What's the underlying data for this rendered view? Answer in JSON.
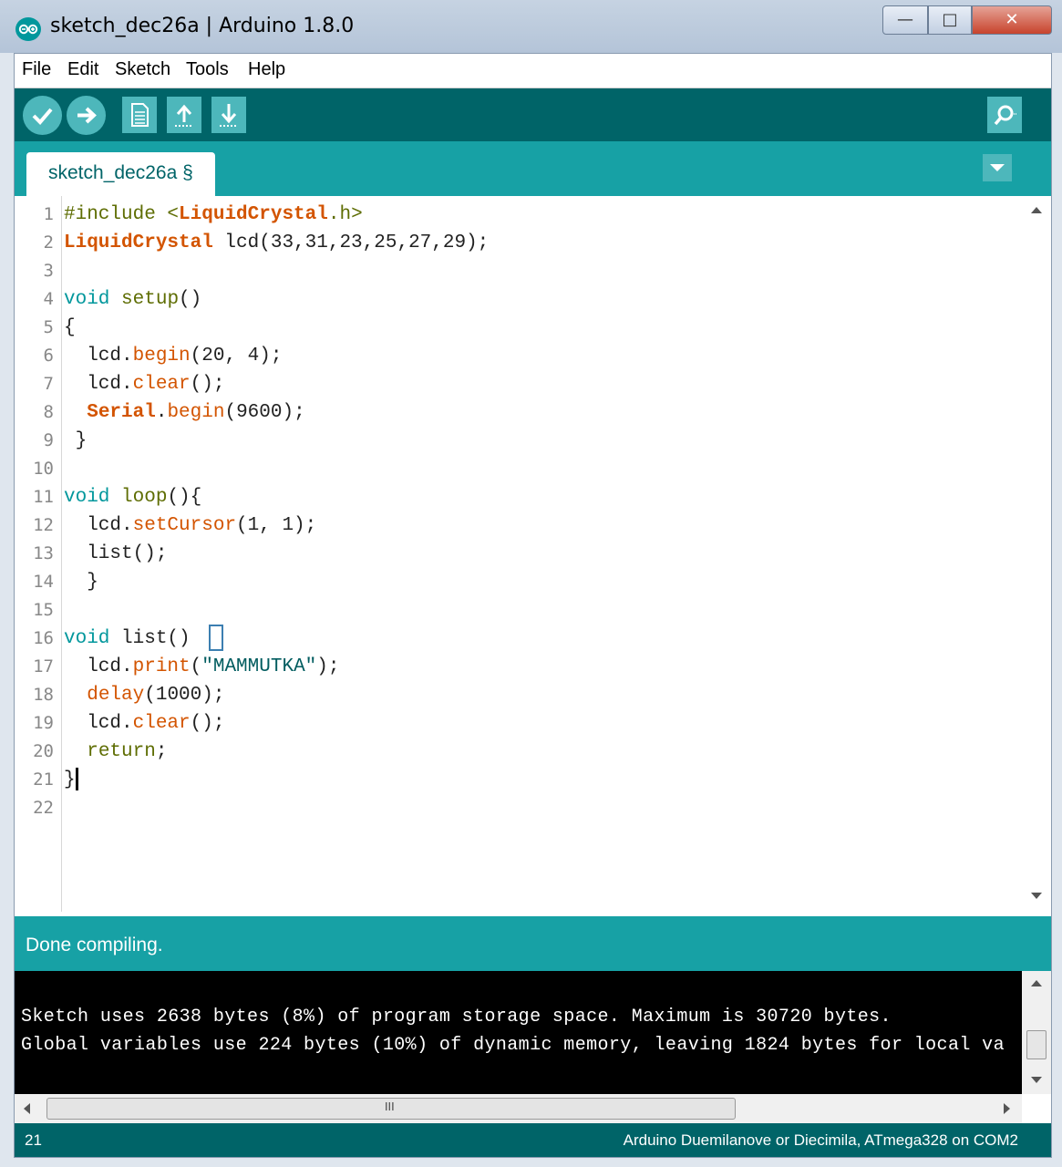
{
  "window": {
    "title": "sketch_dec26a | Arduino 1.8.0",
    "controls": {
      "minimize": "—",
      "maximize": "□",
      "close": "✕"
    }
  },
  "menu": {
    "items": [
      "File",
      "Edit",
      "Sketch",
      "Tools",
      "Help"
    ]
  },
  "toolbar": {
    "buttons": [
      "verify-icon",
      "upload-icon",
      "new-icon",
      "open-icon",
      "save-icon"
    ],
    "serial_monitor_icon": "serial-monitor-icon"
  },
  "tabs": [
    {
      "label": "sketch_dec26a §"
    }
  ],
  "editor": {
    "line_numbers": [
      "1",
      "2",
      "3",
      "4",
      "5",
      "6",
      "7",
      "8",
      "9",
      "10",
      "11",
      "12",
      "13",
      "14",
      "15",
      "16",
      "17",
      "18",
      "19",
      "20",
      "21",
      "22"
    ],
    "lines": [
      [
        {
          "t": "#include <",
          "c": "kw-olive"
        },
        {
          "t": "LiquidCrystal",
          "c": "kw-bold"
        },
        {
          "t": ".h>",
          "c": "kw-olive"
        }
      ],
      [
        {
          "t": "LiquidCrystal",
          "c": "kw-bold"
        },
        {
          "t": " lcd(33,31,23,25,27,29);",
          "c": ""
        }
      ],
      [],
      [
        {
          "t": "void",
          "c": "kw-teal"
        },
        {
          "t": " ",
          "c": ""
        },
        {
          "t": "setup",
          "c": "kw-olive"
        },
        {
          "t": "()",
          "c": ""
        }
      ],
      [
        {
          "t": "{",
          "c": ""
        }
      ],
      [
        {
          "t": "  lcd.",
          "c": ""
        },
        {
          "t": "begin",
          "c": "kw-orange"
        },
        {
          "t": "(20, 4);",
          "c": ""
        }
      ],
      [
        {
          "t": "  lcd.",
          "c": ""
        },
        {
          "t": "clear",
          "c": "kw-orange"
        },
        {
          "t": "();",
          "c": ""
        }
      ],
      [
        {
          "t": "  ",
          "c": ""
        },
        {
          "t": "Serial",
          "c": "kw-bold"
        },
        {
          "t": ".",
          "c": ""
        },
        {
          "t": "begin",
          "c": "kw-orange"
        },
        {
          "t": "(9600);",
          "c": ""
        }
      ],
      [
        {
          "t": " }",
          "c": ""
        }
      ],
      [],
      [
        {
          "t": "void",
          "c": "kw-teal"
        },
        {
          "t": " ",
          "c": ""
        },
        {
          "t": "loop",
          "c": "kw-olive"
        },
        {
          "t": "(){",
          "c": ""
        }
      ],
      [
        {
          "t": "  lcd.",
          "c": ""
        },
        {
          "t": "setCursor",
          "c": "kw-orange"
        },
        {
          "t": "(1, 1);",
          "c": ""
        }
      ],
      [
        {
          "t": "  list();",
          "c": ""
        }
      ],
      [
        {
          "t": "  }",
          "c": ""
        }
      ],
      [],
      [
        {
          "t": "void",
          "c": "kw-teal"
        },
        {
          "t": " list() ",
          "c": ""
        },
        {
          "t": "BRACKET",
          "c": "box"
        }
      ],
      [
        {
          "t": "  lcd.",
          "c": ""
        },
        {
          "t": "print",
          "c": "kw-orange"
        },
        {
          "t": "(",
          "c": ""
        },
        {
          "t": "\"MAMMUTKA\"",
          "c": "str"
        },
        {
          "t": ");",
          "c": ""
        }
      ],
      [
        {
          "t": "  ",
          "c": ""
        },
        {
          "t": "delay",
          "c": "kw-orange"
        },
        {
          "t": "(1000);",
          "c": ""
        }
      ],
      [
        {
          "t": "  lcd.",
          "c": ""
        },
        {
          "t": "clear",
          "c": "kw-orange"
        },
        {
          "t": "();",
          "c": ""
        }
      ],
      [
        {
          "t": "  ",
          "c": ""
        },
        {
          "t": "return",
          "c": "kw-olive"
        },
        {
          "t": ";",
          "c": ""
        }
      ],
      [
        {
          "t": "}",
          "c": ""
        },
        {
          "t": "CARET",
          "c": "caret"
        }
      ],
      []
    ]
  },
  "status": {
    "message": "Done compiling."
  },
  "console": {
    "lines": [
      "Sketch uses 2638 bytes (8%) of program storage space. Maximum is 30720 bytes.",
      "Global variables use 224 bytes (10%) of dynamic memory, leaving 1824 bytes for local va"
    ],
    "hscroll_grip": "III"
  },
  "footer": {
    "line_number": "21",
    "board": "Arduino Duemilanove or Diecimila, ATmega328 on COM2"
  },
  "colors": {
    "toolbar": "#006468",
    "tabbar": "#17a1a5",
    "button": "#4db7bb",
    "keyword_teal": "#00979c",
    "keyword_orange": "#d35400",
    "keyword_olive": "#5e6d03"
  }
}
